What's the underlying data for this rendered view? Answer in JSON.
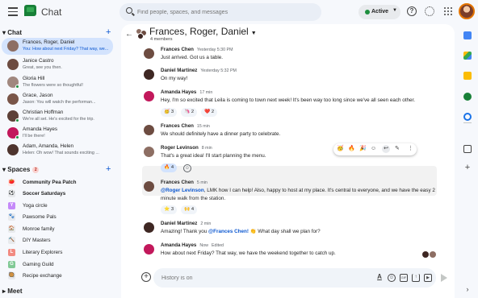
{
  "app": {
    "title": "Chat",
    "search_placeholder": "Find people, spaces, and messages",
    "status": "Active"
  },
  "sidebar": {
    "chat_header": "Chat",
    "chats": [
      {
        "name": "Frances, Roger, Daniel",
        "preview": "You: How about next Friday? That way, we...",
        "color": "#8d6e63"
      },
      {
        "name": "Janice Castro",
        "preview": "Great, see you then.",
        "color": "#6d4c41"
      },
      {
        "name": "Gloria Hill",
        "preview": "The flowers were so thoughtful!",
        "color": "#a1887f"
      },
      {
        "name": "Grace, Jason",
        "preview": "Jason: You will watch the performan...",
        "color": "#795548"
      },
      {
        "name": "Christian Hoffman",
        "preview": "We're all set. He's excited for the trip.",
        "color": "#5d4037"
      },
      {
        "name": "Amanda Hayes",
        "preview": "I'll be there!",
        "color": "#c2185b"
      },
      {
        "name": "Adam, Amanda, Helen",
        "preview": "Helen: Oh wow! That sounds exciting ...",
        "color": "#4e342e"
      }
    ],
    "spaces_header": "Spaces",
    "spaces_badge": "2",
    "spaces": [
      {
        "name": "Community Pea Patch",
        "icon": "🍅",
        "bg": "#fce8e6",
        "bold": true
      },
      {
        "name": "Soccer Saturdays",
        "icon": "⚽",
        "bg": "#e8eaed",
        "bold": true
      },
      {
        "name": "Yoga circle",
        "icon": "Y",
        "bg": "#c58af9",
        "bold": false
      },
      {
        "name": "Pawsome Pals",
        "icon": "🐾",
        "bg": "#e8eaed",
        "bold": false
      },
      {
        "name": "Monroe family",
        "icon": "🏠",
        "bg": "#e8eaed",
        "bold": false
      },
      {
        "name": "DIY Masters",
        "icon": "🔨",
        "bg": "#e8eaed",
        "bold": false
      },
      {
        "name": "Literary Explorers",
        "icon": "L",
        "bg": "#f28b82",
        "bold": false
      },
      {
        "name": "Gaming Guild",
        "icon": "G",
        "bg": "#81c995",
        "bold": false
      },
      {
        "name": "Recipe exchange",
        "icon": "🥘",
        "bg": "#e8eaed",
        "bold": false
      }
    ],
    "meet_header": "Meet"
  },
  "conversation": {
    "title": "Frances, Roger, Daniel",
    "members": "4 members",
    "messages": [
      {
        "author": "Frances Chen",
        "time": "Yesterday 5:30 PM",
        "lines": [
          "Just arrived.  Got us a table."
        ],
        "color": "#6d4c41"
      },
      {
        "author": "Daniel Martinez",
        "time": "Yesterday 5:32 PM",
        "lines": [
          "On my way!"
        ],
        "color": "#3e2723"
      },
      {
        "author": "Amanda Hayes",
        "time": "17 min",
        "lines": [
          "Hey, I'm so excited that Leila is coming to town next week! It's been way too long since we've all seen each other."
        ],
        "color": "#c2185b"
      },
      {
        "author": "Frances Chen",
        "time": "15 min",
        "lines": [
          "We should definitely have a dinner party to celebrate."
        ],
        "color": "#6d4c41"
      },
      {
        "author": "Roger Levinson",
        "time": "8 min",
        "lines": [
          "That's a great idea! I'll start planning the menu."
        ],
        "color": "#8d6e63"
      },
      {
        "author": "Frances Chen",
        "time": "5 min",
        "mention": "@Roger Levinson",
        "lines": [
          ", LMK how I can help!  Also, happy to host at my place. It's central to everyone, and we have the easy 2",
          "minute walk from the station."
        ],
        "color": "#6d4c41"
      },
      {
        "author": "Daniel Martinez",
        "time": "2 min",
        "before": "Amazing! Thank you ",
        "mention": "@Frances Chen!",
        "lines": [
          "👏 What day shall we plan for?"
        ],
        "color": "#3e2723"
      },
      {
        "author": "Amanda Hayes",
        "time": "Now",
        "edited": "Edited",
        "lines": [
          "How about next Friday? That way, we have the weekend together to catch up."
        ],
        "color": "#c2185b"
      }
    ],
    "reactions": {
      "amanda1": [
        "🥳 3",
        "🦄 2",
        "❤️ 2"
      ],
      "roger": [
        "🔥 4"
      ],
      "frances2": [
        "⭐ 3",
        "🙌 4"
      ]
    },
    "composer_placeholder": "History is on"
  }
}
